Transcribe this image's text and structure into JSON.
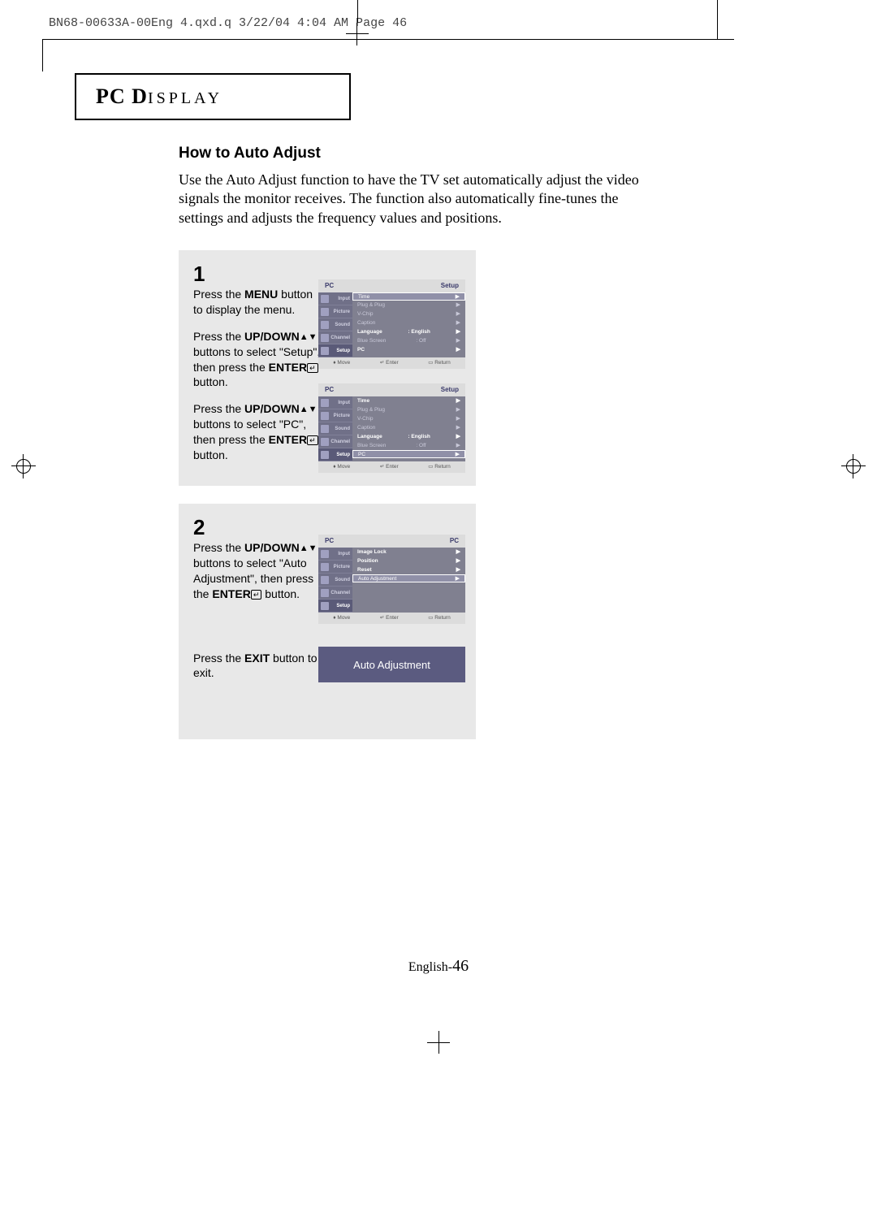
{
  "print_header": "BN68-00633A-00Eng 4.qxd.q  3/22/04 4:04 AM  Page 46",
  "section_title_bold": "PC D",
  "section_title_caps": "ISPLAY",
  "subtitle": "How to Auto Adjust",
  "body": "Use the Auto Adjust function to have the TV set automatically adjust the video signals the monitor receives. The function also automatically fine-tunes the settings and adjusts the frequency values and positions.",
  "step1": {
    "num": "1",
    "p1a": "Press the ",
    "p1b": "MENU",
    "p1c": " button to display the menu.",
    "p2a": "Press the ",
    "p2b": "UP/DOWN",
    "p2c": " buttons to select \"Setup\", then press the ",
    "p2d": "ENTER",
    "p2e": " button.",
    "p3a": "Press the ",
    "p3b": "UP/DOWN",
    "p3c": " buttons to select \"PC\", then press the ",
    "p3d": "ENTER",
    "p3e": " button."
  },
  "step2": {
    "num": "2",
    "p1a": "Press the ",
    "p1b": "UP/DOWN",
    "p1c": " buttons to select \"Auto Adjustment\", then press the ",
    "p1d": "ENTER",
    "p1e": " button.",
    "p2a": "Press the ",
    "p2b": "EXIT",
    "p2c": " button to exit."
  },
  "osd_sidebar": [
    "Input",
    "Picture",
    "Sound",
    "Channel",
    "Setup"
  ],
  "osd1": {
    "hl": "PC",
    "hr": "Setup",
    "rows": [
      {
        "l": "Time",
        "r": "▶",
        "cls": "hl"
      },
      {
        "l": "Plug & Plug",
        "r": "▶"
      },
      {
        "l": "V-Chip",
        "r": "▶"
      },
      {
        "l": "Caption",
        "r": "▶"
      },
      {
        "l": "Language",
        "m": ": English",
        "r": "▶",
        "cls": "white"
      },
      {
        "l": "Blue Screen",
        "m": ": Off",
        "r": "▶"
      },
      {
        "l": "PC",
        "r": "▶",
        "cls": "white"
      }
    ]
  },
  "osd2": {
    "hl": "PC",
    "hr": "Setup",
    "rows": [
      {
        "l": "Time",
        "r": "▶",
        "cls": "white"
      },
      {
        "l": "Plug & Plug",
        "r": "▶"
      },
      {
        "l": "V-Chip",
        "r": "▶"
      },
      {
        "l": "Caption",
        "r": "▶"
      },
      {
        "l": "Language",
        "m": ": English",
        "r": "▶",
        "cls": "white"
      },
      {
        "l": "Blue Screen",
        "m": ": Off",
        "r": "▶"
      },
      {
        "l": "PC",
        "r": "▶",
        "cls": "hl"
      }
    ]
  },
  "osd3": {
    "hl": "PC",
    "hr": "PC",
    "rows": [
      {
        "l": "Image Lock",
        "r": "▶",
        "cls": "white"
      },
      {
        "l": "Position",
        "r": "▶",
        "cls": "white"
      },
      {
        "l": "Reset",
        "r": "▶",
        "cls": "white"
      },
      {
        "l": "Auto Adjustment",
        "r": "▶",
        "cls": "hl"
      }
    ]
  },
  "osd_footer": {
    "move": "Move",
    "enter": "Enter",
    "return": "Return"
  },
  "auto_banner": "Auto Adjustment",
  "page_footer_lang": "English-",
  "page_footer_num": "46",
  "glyphs": {
    "up": "▲",
    "down": "▼",
    "updown": "♦",
    "enter": "↵",
    "return": "▭"
  }
}
